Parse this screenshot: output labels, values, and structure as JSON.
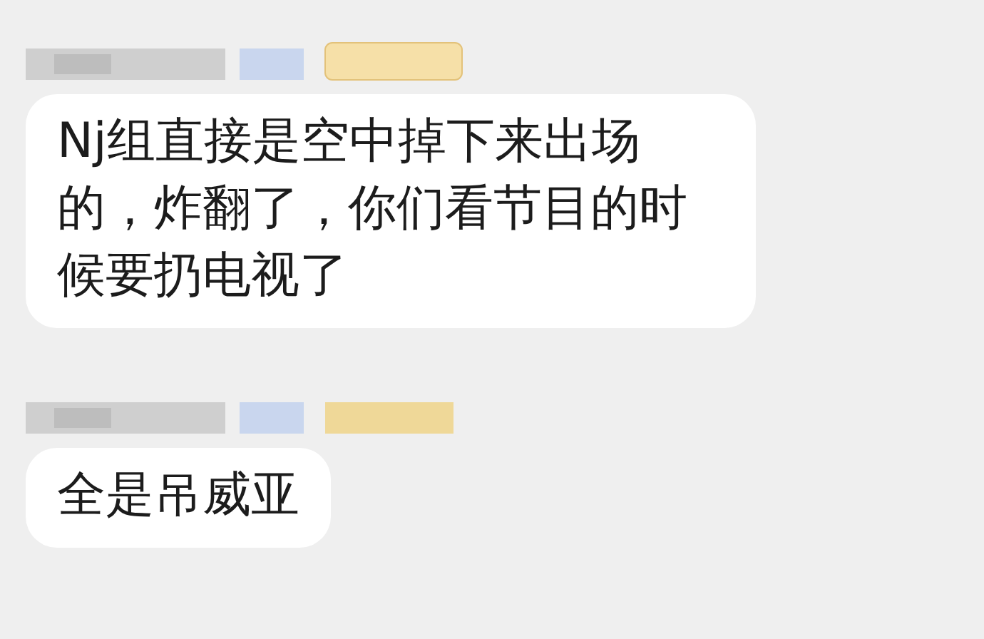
{
  "messages": [
    {
      "text": "Nj组直接是空中掉下来出场的，炸翻了，你们看节目的时候要扔电视了",
      "badge": true
    },
    {
      "text": "全是吊威亚",
      "badge": false
    }
  ]
}
